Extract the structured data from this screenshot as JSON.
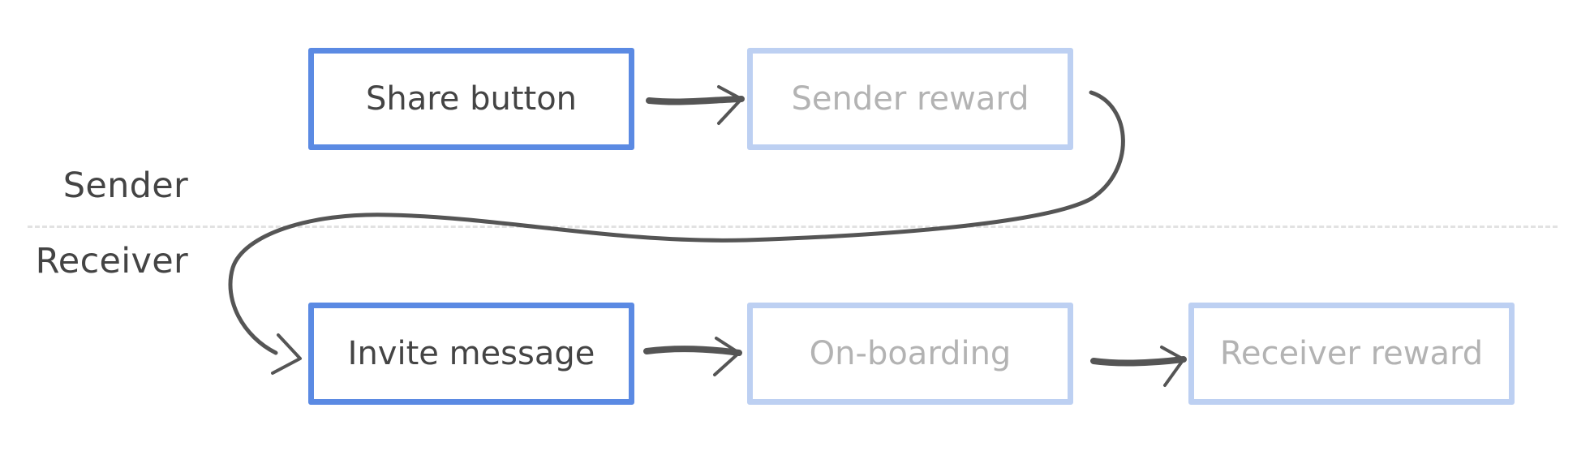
{
  "lanes": {
    "sender": "Sender",
    "receiver": "Receiver"
  },
  "nodes": {
    "share_button": {
      "label": "Share button",
      "state": "active"
    },
    "sender_reward": {
      "label": "Sender reward",
      "state": "inactive"
    },
    "invite_message": {
      "label": "Invite message",
      "state": "active"
    },
    "onboarding": {
      "label": "On-boarding",
      "state": "inactive"
    },
    "receiver_reward": {
      "label": "Receiver reward",
      "state": "inactive"
    }
  },
  "edges": [
    {
      "from": "Share button",
      "to": "Sender reward"
    },
    {
      "from": "Sender reward",
      "to": "Invite message"
    },
    {
      "from": "Invite message",
      "to": "On-boarding"
    },
    {
      "from": "On-boarding",
      "to": "Receiver reward"
    }
  ],
  "colors": {
    "active_border": "#5b8ae3",
    "inactive_border": "#bdd0f2",
    "active_text": "#444444",
    "inactive_text": "#b3b3b3",
    "arrow": "#555555",
    "divider": "#e2e2e2"
  }
}
